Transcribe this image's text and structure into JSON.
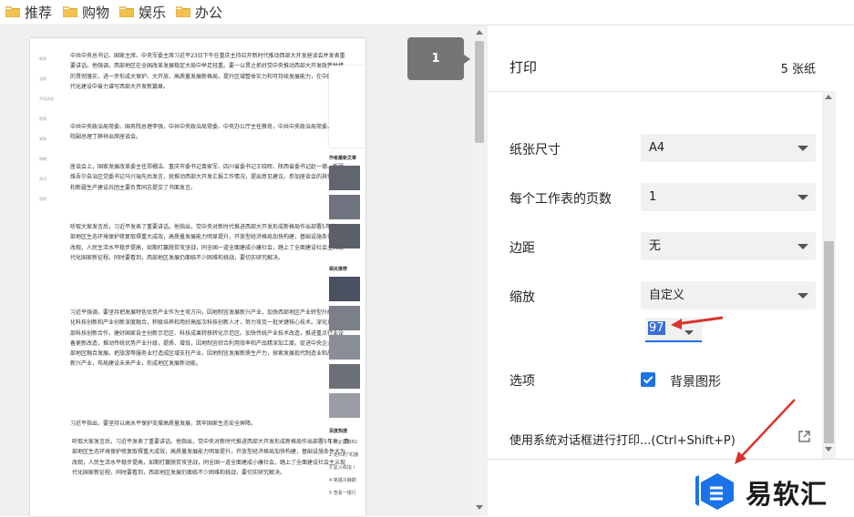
{
  "bookmarks": [
    {
      "label": "推荐"
    },
    {
      "label": "购物"
    },
    {
      "label": "娱乐"
    },
    {
      "label": "办公"
    }
  ],
  "preview": {
    "page_number": "1",
    "nav_items": [
      "新闻",
      "全网",
      "手机浏览",
      "视频",
      "采购",
      "购物",
      "资讯",
      "游戏"
    ],
    "paragraphs": [
      "中共中央总书记、国家主席、中央军委主席习近平23日下午在重庆主持召开新时代推动西部大开发座谈会并发表重要讲话。他强调，西部地区在全国改革发展稳定大局中举足轻重。要一以贯之抓好党中央推动西部大开发政策举措的贯彻落实，进一步形成大保护、大开放、高质量发展新格局，提升区域整体实力和可持续发展能力，在中国式现代化建设中奋力谱写西部大开发新篇章。",
      "中共中央政治局常委、国务院总理李强，中共中央政治局常委、中央办公厅主任蔡奇，中共中央政治局常委、国务院副总理丁薛祥出席座谈会。",
      "座谈会上，国家发展改革委主任郑栅洁、重庆市委书记袁家军、四川省委书记王晓晖、陕西省委书记赵一德、新疆维吾尔自治区党委书记马兴瑞先后发言，就推动西部大开发汇报工作情况，提出意见建议。参加座谈会的其他省区和新疆生产建设兵团主要负责同志提交了书面发言。",
      "听取大家发言后，习近平发表了重要讲话。他指出，党中央对新时代推进西部大开发形成新格局作出部署5年来，西部地区生态环境保护修复取得重大成效，高质量发展能力明显提升，开放型经济格局加快构建，基础设施条件大为改观，人民生活水平稳步提高，如期打赢脱贫攻坚战，同全国一道全面建成小康社会，踏上了全面建设社会主义现代化国家新征程。同时要看到，西部地区发展仍面临不少困难和挑战，要切实研究解决。",
      "习近平强调，要坚持把发展特色优势产业作为主攻方向，因地制宜发展新兴产业，加快西部地区产业转型升级。强化科技创新和产业创新深度融合，积极培养和用好高层次科技创新人才，努力攻克一批关键核心技术。深化东中西部科技创新合作，建好国家自主创新示范区、科技成果转移转化示范区。加快传统产业技术改造，推进重点行业设备更新改造，推动传统优势产业升级，提质、增效，因地制宜综合利用效率和产品精深加工度。促进中央企业与西部地区融合发展。把旅游等服务业打造成区域支柱产业。因地制宜发展新质生产力，探索发展现代制造业和战略性新兴产业，布局建设未来产业，形成地区发展新动能。",
      "习近平指出，要坚持以高水平保护支撑高质量发展，筑牢国家生态安全屏障。",
      "听取大家发言后，习近平发表了重要讲话。他指出，党中央对新时代推进西部大开发形成新格局作出部署5年来，西部地区生态环境保护修复取得重大成效，高质量发展能力明显提升，开放型经济格局加快构建，基础设施条件大为改观，人民生活水平稳步提高，如期打赢脱贫攻坚战，同全国一道全面建成小康社会，踏上了全面建设社会主义现代化国家新征程。同时要看到，西部地区发展仍面临不少困难和挑战，要切实研究解决。"
    ],
    "side_heading_1": "作者最新文章",
    "side_heading_2": "相关推荐",
    "side_heading_3": "百度热搜",
    "hot_list": [
      "1 烈士遗骸82",
      "2 走红的\"机器",
      "3 星火戒指丨",
      "4 离婚冷静期",
      "5 查看一银行"
    ]
  },
  "panel": {
    "title": "打印",
    "sheet_count": "5 张纸",
    "paper_size_label": "纸张尺寸",
    "paper_size_value": "A4",
    "pages_per_sheet_label": "每个工作表的页数",
    "pages_per_sheet_value": "1",
    "margins_label": "边距",
    "margins_value": "无",
    "scale_label": "缩放",
    "scale_value": "自定义",
    "scale_custom_value": "97",
    "options_label": "选项",
    "background_graphics_label": "背景图形",
    "background_graphics_checked": true,
    "system_dialog_label": "使用系统对话框进行打印...(Ctrl+Shift+P)"
  },
  "watermark": {
    "text": "易软汇",
    "accent": "#1a73e8"
  },
  "colors": {
    "folder": "#f2c14e",
    "annotation_arrow": "#d9342b",
    "badge": "#757575"
  }
}
